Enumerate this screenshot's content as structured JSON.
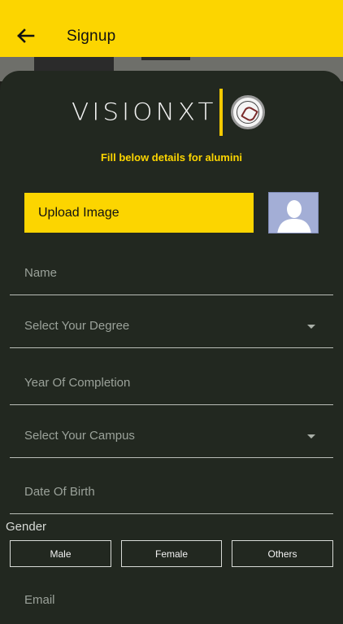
{
  "appbar": {
    "title": "Signup",
    "back_icon": "arrow-left-icon"
  },
  "logo": {
    "text": "VISIONXT",
    "seal_icon": "university-seal-icon"
  },
  "subtitle": "Fill below details for alumini",
  "upload": {
    "label": "Upload Image"
  },
  "avatar": {
    "icon": "default-profile-icon"
  },
  "fields": {
    "name": "Name",
    "degree": "Select Your Degree",
    "year": "Year Of Completion",
    "campus": "Select Your Campus",
    "dob": "Date Of Birth",
    "email": "Email"
  },
  "gender": {
    "label": "Gender",
    "options": [
      "Male",
      "Female",
      "Others"
    ]
  },
  "colors": {
    "accent": "#fcd500",
    "card": "#222820",
    "text_muted": "#9ba29a"
  }
}
